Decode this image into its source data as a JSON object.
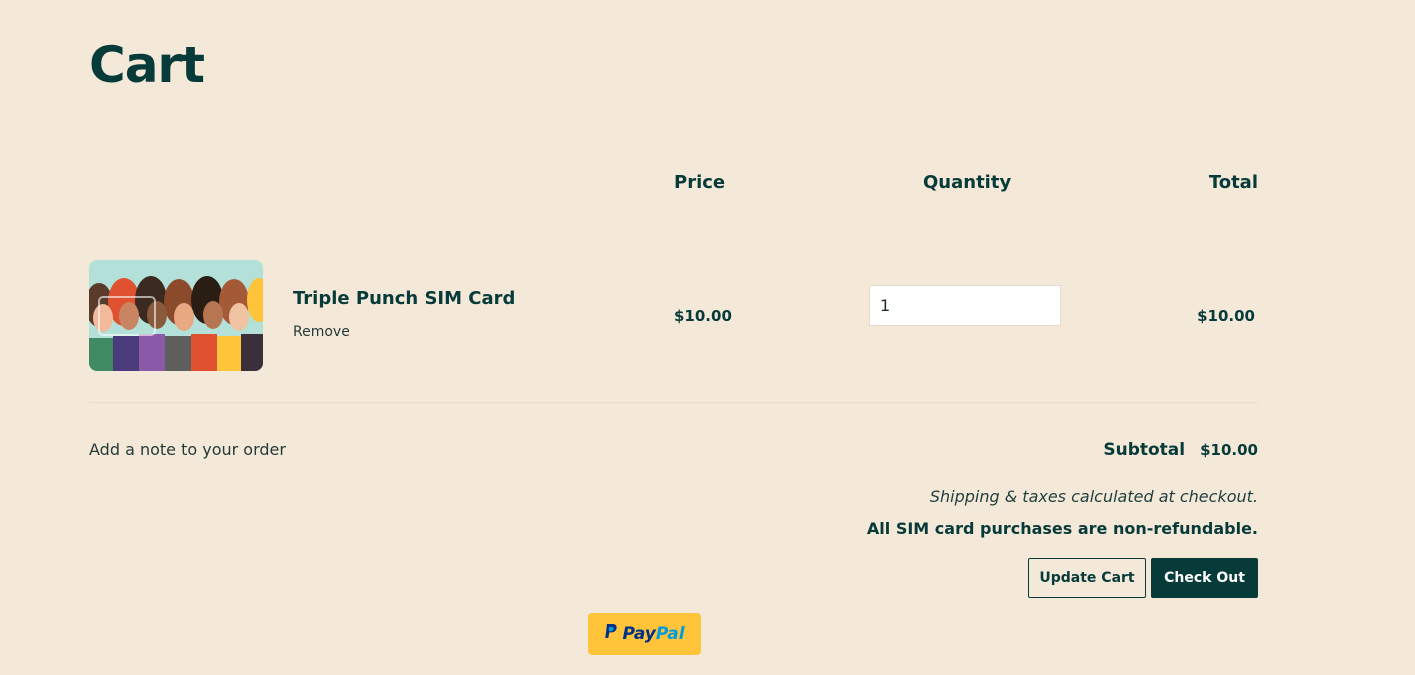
{
  "page": {
    "title": "Cart"
  },
  "table": {
    "headers": {
      "price": "Price",
      "quantity": "Quantity",
      "total": "Total"
    },
    "items": [
      {
        "name": "Triple Punch SIM Card",
        "remove_label": "Remove",
        "price": "$10.00",
        "quantity": "1",
        "total": "$10.00"
      }
    ]
  },
  "footer": {
    "note_link": "Add a note to your order",
    "subtotal_label": "Subtotal",
    "subtotal_value": "$10.00",
    "shipping_note": "Shipping & taxes calculated at checkout.",
    "refund_note": "All SIM card purchases are non-refundable.",
    "update_button": "Update Cart",
    "checkout_button": "Check Out"
  },
  "paypal": {
    "text_pay": "Pay",
    "text_pal": "Pal",
    "icon": "paypal-p-icon"
  },
  "colors": {
    "background": "#f4e8d9",
    "primary": "#073b3a",
    "paypal_yellow": "#ffc439",
    "paypal_dark_blue": "#003087",
    "paypal_light_blue": "#009cde"
  }
}
